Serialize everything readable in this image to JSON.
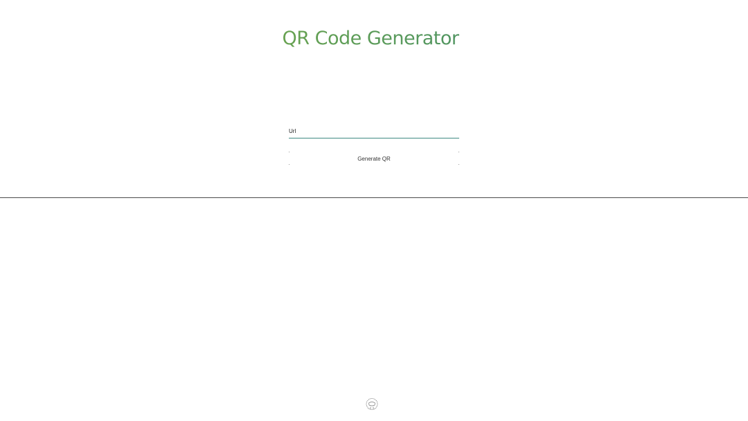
{
  "header": {
    "title": "QR Code Generator"
  },
  "form": {
    "url_placeholder": "Url",
    "url_value": "",
    "generate_label": "Generate QR"
  },
  "footer": {
    "icon": "octocat-icon"
  },
  "colors": {
    "title_gradient_start": "#9bb93a",
    "title_gradient_end": "#2f7f7a",
    "input_underline": "#3f8a82",
    "divider": "#4a4a4a"
  }
}
